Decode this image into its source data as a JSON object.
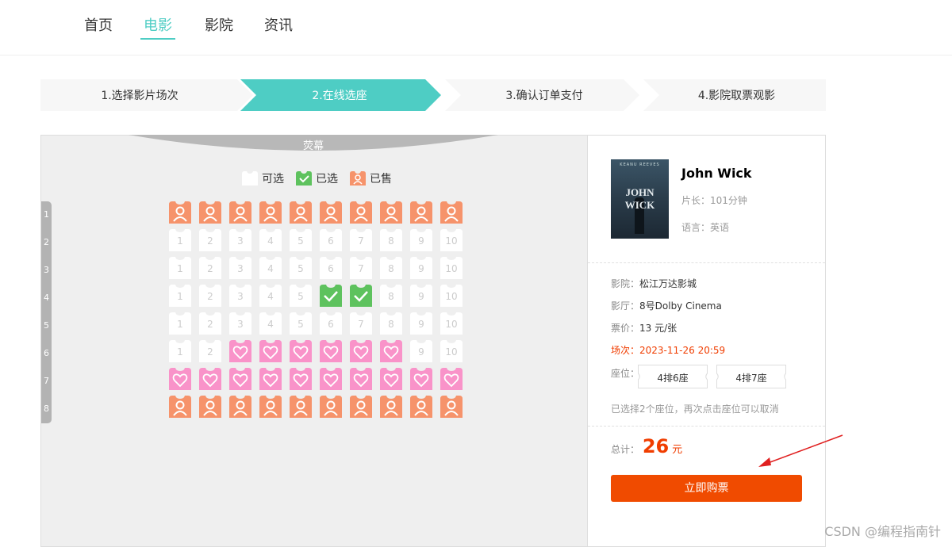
{
  "nav": {
    "items": [
      {
        "label": "首页",
        "active": false
      },
      {
        "label": "电影",
        "active": true
      },
      {
        "label": "影院",
        "active": false
      },
      {
        "label": "资讯",
        "active": false
      }
    ]
  },
  "steps": [
    {
      "label": "1.选择影片场次",
      "active": false
    },
    {
      "label": "2.在线选座",
      "active": true
    },
    {
      "label": "3.确认订单支付",
      "active": false
    },
    {
      "label": "4.影院取票观影",
      "active": false
    }
  ],
  "screen_label": "荧幕",
  "legend": {
    "available": "可选",
    "selected": "已选",
    "sold": "已售"
  },
  "rows": [
    "1",
    "2",
    "3",
    "4",
    "5",
    "6",
    "7",
    "8"
  ],
  "seat_map": [
    [
      "sold",
      "sold",
      "sold",
      "sold",
      "sold",
      "sold",
      "sold",
      "sold",
      "sold",
      "sold"
    ],
    [
      "available",
      "available",
      "available",
      "available",
      "available",
      "available",
      "available",
      "available",
      "available",
      "available"
    ],
    [
      "available",
      "available",
      "available",
      "available",
      "available",
      "available",
      "available",
      "available",
      "available",
      "available"
    ],
    [
      "available",
      "available",
      "available",
      "available",
      "available",
      "selected",
      "selected",
      "available",
      "available",
      "available"
    ],
    [
      "available",
      "available",
      "available",
      "available",
      "available",
      "available",
      "available",
      "available",
      "available",
      "available"
    ],
    [
      "available",
      "available",
      "couple",
      "couple",
      "couple",
      "couple",
      "couple",
      "couple",
      "available",
      "available"
    ],
    [
      "couple",
      "couple",
      "couple",
      "couple",
      "couple",
      "couple",
      "couple",
      "couple",
      "couple",
      "couple"
    ],
    [
      "sold",
      "sold",
      "sold",
      "sold",
      "sold",
      "sold",
      "sold",
      "sold",
      "sold",
      "sold"
    ]
  ],
  "movie": {
    "poster_top": "KEANU REEVES",
    "poster_title": "JOHN WICK",
    "title": "John Wick",
    "duration": "片长：101分钟",
    "language": "语言：英语"
  },
  "order": {
    "cinema_label": "影院：",
    "cinema": "松江万达影城",
    "hall_label": "影厅：",
    "hall": "8号Dolby Cinema",
    "price_label": "票价：",
    "price": "13 元/张",
    "time_label": "场次：",
    "time": "2023-11-26 20:59",
    "seats_label": "座位：",
    "seats": [
      "4排6座",
      "4排7座"
    ],
    "hint": "已选择2个座位，再次点击座位可以取消",
    "total_label": "总计：",
    "total": "26",
    "total_unit": "元",
    "buy_label": "立即购票"
  },
  "watermark": "CSDN @编程指南针",
  "colors": {
    "accent": "#4ecdc4",
    "sold": "#f6936b",
    "selected": "#5ec25e",
    "couple": "#f993c9",
    "buy": "#f04b00"
  }
}
